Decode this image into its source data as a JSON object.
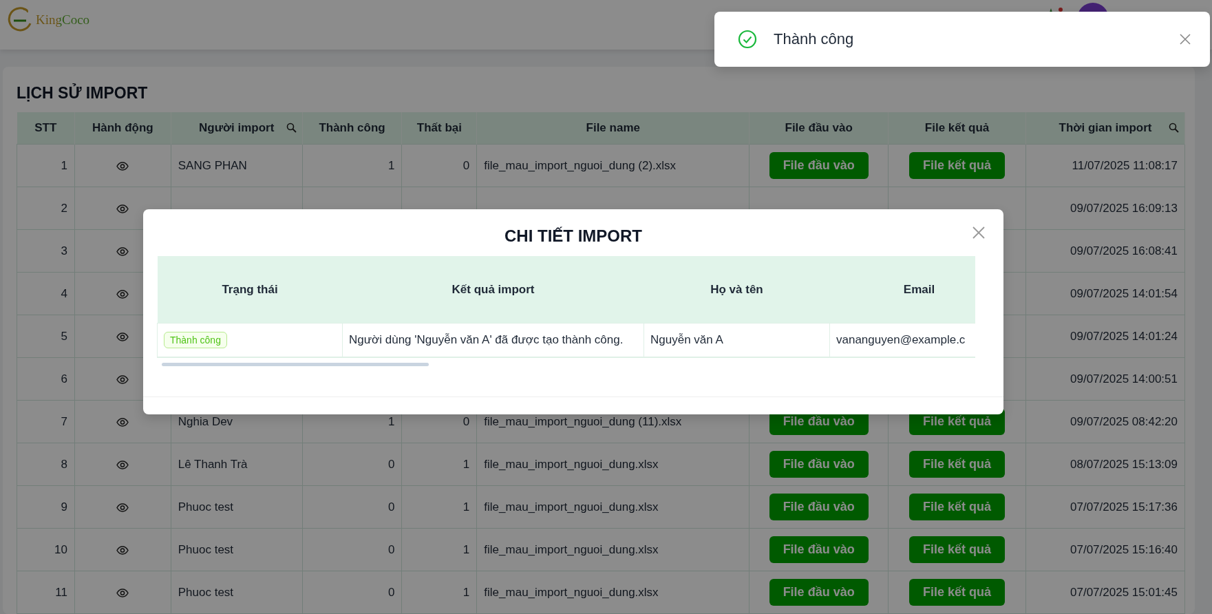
{
  "header": {
    "logo_text": "KingCoco"
  },
  "page": {
    "title": "LỊCH SỬ IMPORT"
  },
  "table": {
    "columns": [
      {
        "label": "STT",
        "filterable": false
      },
      {
        "label": "Hành động",
        "filterable": false
      },
      {
        "label": "Người import",
        "filterable": true
      },
      {
        "label": "Thành công",
        "filterable": false
      },
      {
        "label": "Thất bại",
        "filterable": false
      },
      {
        "label": "File name",
        "filterable": false
      },
      {
        "label": "File đầu vào",
        "filterable": false
      },
      {
        "label": "File kết quả",
        "filterable": false
      },
      {
        "label": "Thời gian import",
        "filterable": true
      }
    ],
    "rows": [
      {
        "stt": "1",
        "user": "SANG PHAN",
        "success": "1",
        "failed": "0",
        "file_name": "file_mau_import_nguoi_dung (2).xlsx",
        "input_button": "File đầu vào",
        "result_button": "File kết quả",
        "time": "11/07/2025 11:08:17"
      },
      {
        "stt": "2",
        "time": "09/07/2025 16:09:13"
      },
      {
        "stt": "3",
        "time": "09/07/2025 16:08:41"
      },
      {
        "stt": "4",
        "time": "09/07/2025 14:01:54"
      },
      {
        "stt": "5",
        "time": "09/07/2025 14:01:24"
      },
      {
        "stt": "6",
        "time": "09/07/2025 14:00:51"
      },
      {
        "stt": "7",
        "user": "Nghia Dev",
        "success": "1",
        "failed": "0",
        "file_name": "file_mau_import_nguoi_dung (11).xlsx",
        "input_button": "File đầu vào",
        "result_button": "File kết quả",
        "time": "09/07/2025 08:42:20"
      },
      {
        "stt": "8",
        "user": "Lê Thanh Trà",
        "success": "0",
        "failed": "1",
        "file_name": "file_mau_import_nguoi_dung.xlsx",
        "input_button": "File đầu vào",
        "result_button": "File kết quả",
        "time": "08/07/2025 15:13:09"
      },
      {
        "stt": "9",
        "user": "Phuoc test",
        "success": "0",
        "failed": "1",
        "file_name": "file_mau_import_nguoi_dung.xlsx",
        "input_button": "File đầu vào",
        "result_button": "File kết quả",
        "time": "07/07/2025 15:17:36"
      },
      {
        "stt": "10",
        "user": "Phuoc test",
        "success": "0",
        "failed": "1",
        "file_name": "file_mau_import_nguoi_dung.xlsx",
        "input_button": "File đầu vào",
        "result_button": "File kết quả",
        "time": "07/07/2025 15:16:40"
      },
      {
        "stt": "11",
        "user": "Phuoc test",
        "success": "0",
        "failed": "1",
        "file_name": "file_mau_import_nguoi_dung.xlsx",
        "input_button": "File đầu vào",
        "result_button": "File kết quả",
        "time": "07/07/2025 15:01:45"
      }
    ]
  },
  "modal": {
    "title": "CHI TIẾT IMPORT",
    "columns": [
      "Trạng thái",
      "Kết quả import",
      "Họ và tên",
      "Email"
    ],
    "rows": [
      {
        "status": {
          "label": "Thành công",
          "kind": "success"
        },
        "result": "Người dùng 'Nguyễn văn A' đã được tạo thành công.",
        "full_name": "Nguyễn văn A",
        "email": "vananguyen@example.c"
      }
    ]
  },
  "toast": {
    "kind": "success",
    "message": "Thành công"
  }
}
